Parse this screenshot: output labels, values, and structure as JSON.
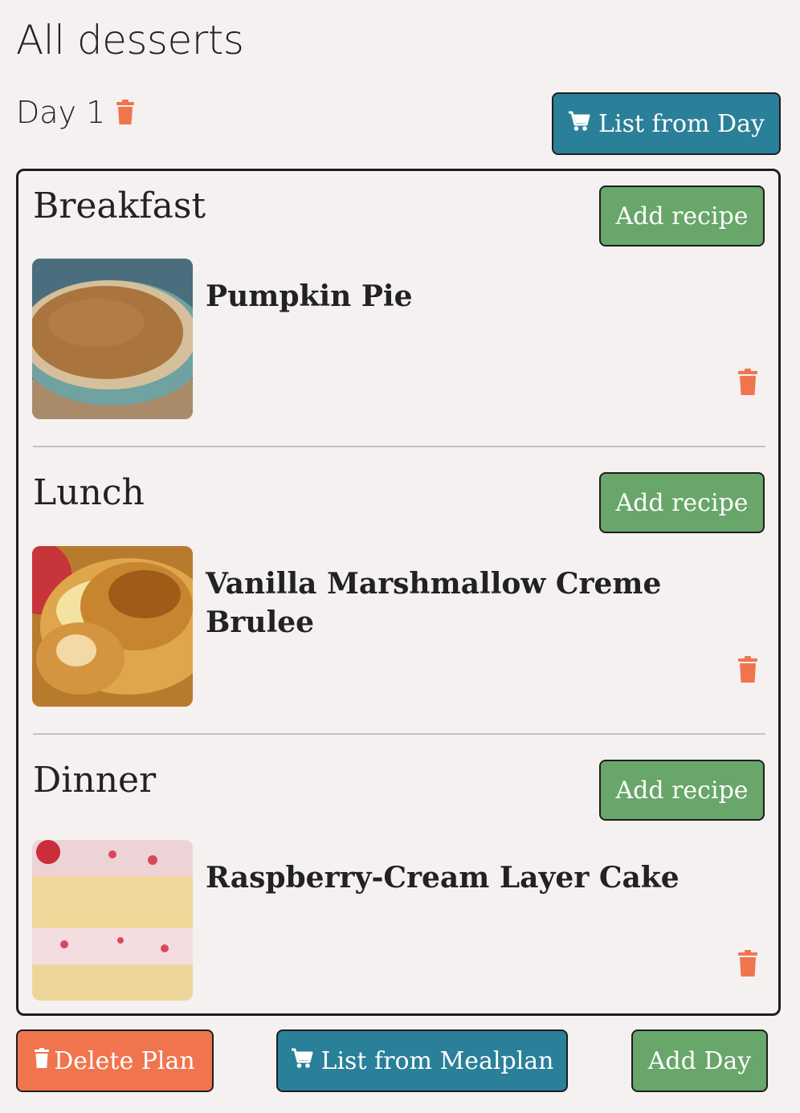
{
  "page": {
    "title": "All desserts"
  },
  "day": {
    "label": "Day 1",
    "list_button": "List from Day"
  },
  "meals": [
    {
      "title": "Breakfast",
      "add_button": "Add recipe",
      "recipe": {
        "name": "Pumpkin Pie"
      }
    },
    {
      "title": "Lunch",
      "add_button": "Add recipe",
      "recipe": {
        "name": "Vanilla Marshmallow Creme Brulee"
      }
    },
    {
      "title": "Dinner",
      "add_button": "Add recipe",
      "recipe": {
        "name": "Raspberry-Cream Layer Cake"
      }
    }
  ],
  "footer": {
    "delete_plan": "Delete Plan",
    "list_from_mealplan": "List from Mealplan",
    "add_day": "Add Day"
  },
  "colors": {
    "background": "#f4f1f0",
    "teal": "#2a7f99",
    "green": "#68a66a",
    "orange": "#f0754f"
  }
}
